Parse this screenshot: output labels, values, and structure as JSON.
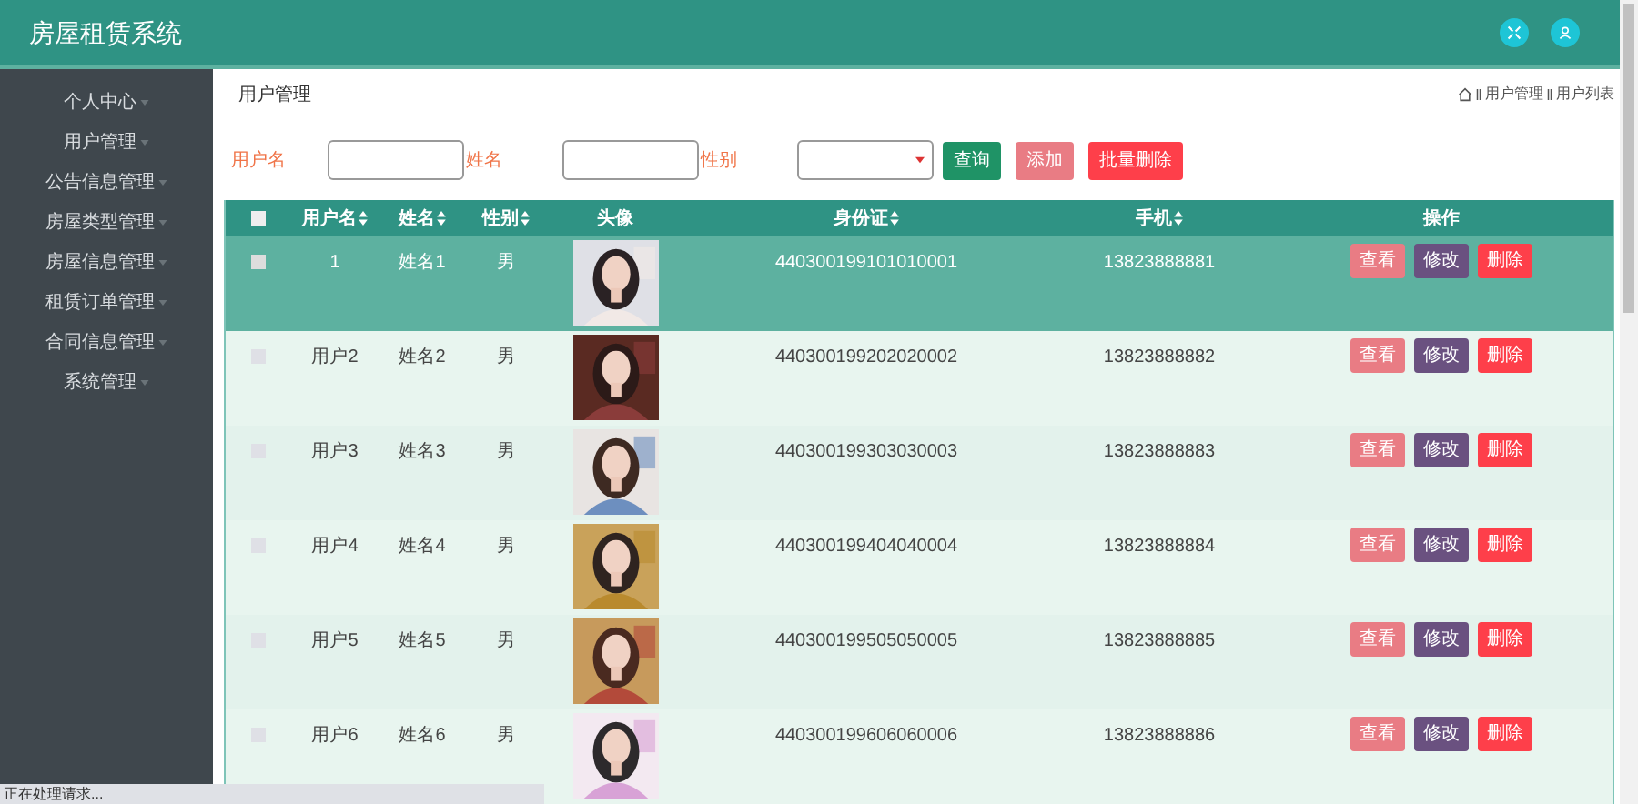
{
  "header": {
    "title": "房屋租赁系统"
  },
  "sidebar": {
    "items": [
      {
        "label": "个人中心"
      },
      {
        "label": "用户管理"
      },
      {
        "label": "公告信息管理"
      },
      {
        "label": "房屋类型管理"
      },
      {
        "label": "房屋信息管理"
      },
      {
        "label": "租赁订单管理"
      },
      {
        "label": "合同信息管理"
      },
      {
        "label": "系统管理"
      }
    ]
  },
  "page_title": "用户管理",
  "breadcrumb": [
    "用户管理",
    "用户列表"
  ],
  "search": {
    "fields": [
      {
        "kind": "text",
        "label": "用户名"
      },
      {
        "kind": "text",
        "label": "姓名"
      },
      {
        "kind": "select",
        "label": "性别"
      }
    ],
    "buttons": [
      {
        "label": "查询",
        "kind": "query"
      },
      {
        "label": "添加",
        "kind": "add"
      },
      {
        "label": "批量删除",
        "kind": "delete"
      }
    ]
  },
  "table": {
    "select_all": {
      "checked": false
    },
    "columns": [
      {
        "label": "用户名",
        "sortable": true
      },
      {
        "label": "姓名",
        "sortable": true
      },
      {
        "label": "性别",
        "sortable": true
      },
      {
        "label": "头像",
        "sortable": false
      },
      {
        "label": "身份证",
        "sortable": true
      },
      {
        "label": "手机",
        "sortable": true
      },
      {
        "label": "操作",
        "sortable": false
      }
    ],
    "rows": [
      {
        "selected": true,
        "checked": false,
        "username": "1",
        "name": "姓名1",
        "gender": "男",
        "id_card": "440300199101010001",
        "phone": "13823888881",
        "actions": [
          {
            "label": "查看",
            "kind": "view"
          },
          {
            "label": "修改",
            "kind": "edit"
          },
          {
            "label": "删除",
            "kind": "delete"
          }
        ]
      },
      {
        "selected": false,
        "checked": false,
        "username": "用户2",
        "name": "姓名2",
        "gender": "男",
        "id_card": "440300199202020002",
        "phone": "13823888882",
        "actions": [
          {
            "label": "查看",
            "kind": "view"
          },
          {
            "label": "修改",
            "kind": "edit"
          },
          {
            "label": "删除",
            "kind": "delete"
          }
        ]
      },
      {
        "selected": false,
        "checked": false,
        "username": "用户3",
        "name": "姓名3",
        "gender": "男",
        "id_card": "440300199303030003",
        "phone": "13823888883",
        "actions": [
          {
            "label": "查看",
            "kind": "view"
          },
          {
            "label": "修改",
            "kind": "edit"
          },
          {
            "label": "删除",
            "kind": "delete"
          }
        ]
      },
      {
        "selected": false,
        "checked": false,
        "username": "用户4",
        "name": "姓名4",
        "gender": "男",
        "id_card": "440300199404040004",
        "phone": "13823888884",
        "actions": [
          {
            "label": "查看",
            "kind": "view"
          },
          {
            "label": "修改",
            "kind": "edit"
          },
          {
            "label": "删除",
            "kind": "delete"
          }
        ]
      },
      {
        "selected": false,
        "checked": false,
        "username": "用户5",
        "name": "姓名5",
        "gender": "男",
        "id_card": "440300199505050005",
        "phone": "13823888885",
        "actions": [
          {
            "label": "查看",
            "kind": "view"
          },
          {
            "label": "修改",
            "kind": "edit"
          },
          {
            "label": "删除",
            "kind": "delete"
          }
        ]
      },
      {
        "selected": false,
        "checked": false,
        "username": "用户6",
        "name": "姓名6",
        "gender": "男",
        "id_card": "440300199606060006",
        "phone": "13823888886",
        "actions": [
          {
            "label": "查看",
            "kind": "view"
          },
          {
            "label": "修改",
            "kind": "edit"
          },
          {
            "label": "删除",
            "kind": "delete"
          }
        ]
      }
    ]
  },
  "status_bar": "正在处理请求..."
}
